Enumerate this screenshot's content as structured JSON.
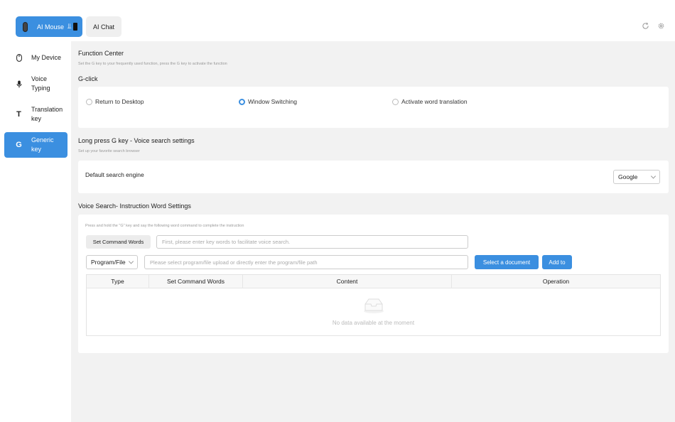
{
  "header": {
    "tabs": [
      {
        "label": "AI Mouse",
        "active": true
      },
      {
        "label": "AI Chat",
        "active": false
      }
    ]
  },
  "sidebar": {
    "items": [
      {
        "label": "My Device",
        "icon": "mouse-icon",
        "active": false
      },
      {
        "label": "Voice\nTyping",
        "icon": "microphone-icon",
        "active": false
      },
      {
        "label": "Translation\nkey",
        "icon": "letter-t-icon",
        "active": false
      },
      {
        "label": "Generic\nkey",
        "icon": "letter-g-icon",
        "active": true
      }
    ]
  },
  "function_center": {
    "title": "Function Center",
    "subtitle": "Set the G key to your frequently used function, press the G key to activate the function"
  },
  "gclick": {
    "title": "G-click",
    "options": [
      {
        "label": "Return to Desktop",
        "selected": false
      },
      {
        "label": "Window Switching",
        "selected": true
      },
      {
        "label": "Activate word translation",
        "selected": false
      }
    ]
  },
  "voice_search": {
    "title": "Long press G key - Voice search settings",
    "subtitle": "Set up your favorite search browser",
    "engine_label": "Default search engine",
    "engine_value": "Google"
  },
  "instruction": {
    "title": "Voice Search- Instruction Word Settings",
    "hint": "Press and hold the \"G\" key and say the following word command to complete the instruction",
    "set_command_button": "Set Command Words",
    "keyword_placeholder": "First, please enter key words to facilitate voice search.",
    "type_select": "Program/File",
    "path_placeholder": "Please select program/file upload or directly enter the program/file path",
    "select_doc_button": "Select a document",
    "add_button": "Add to",
    "table": {
      "columns": [
        "Type",
        "Set Command Words",
        "Content",
        "Operation"
      ],
      "rows": [],
      "empty_text": "No data available at the moment"
    }
  },
  "colors": {
    "accent": "#3b8fe0",
    "background": "#f2f2f2"
  }
}
